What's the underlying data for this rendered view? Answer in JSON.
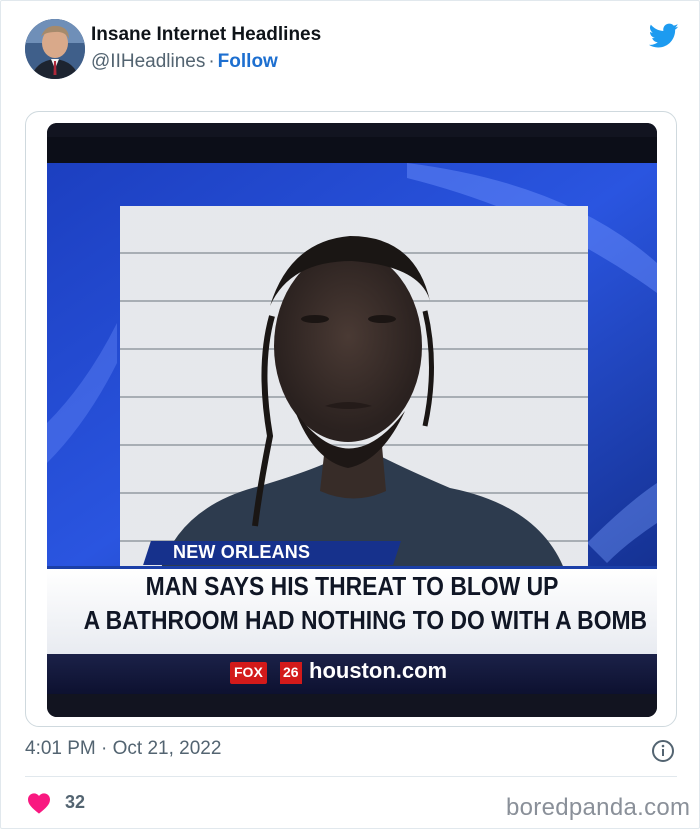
{
  "account": {
    "name": "Insane Internet Headlines",
    "handle": "@IIHeadlines",
    "separator": "·",
    "follow_label": "Follow"
  },
  "icons": {
    "brand": "twitter-bird-icon",
    "info": "info-icon",
    "like": "heart-icon"
  },
  "colors": {
    "twitter_blue": "#1d9bf0",
    "follow_blue": "#1d6fd0",
    "heart": "#f91880",
    "muted_text": "#536471"
  },
  "media": {
    "location": "NEW ORLEANS",
    "headline_line1": "MAN SAYS HIS THREAT TO BLOW UP",
    "headline_line2": "A BATHROOM HAD NOTHING TO DO WITH A BOMB",
    "logo_text": "FOX",
    "logo_number": "26",
    "website": "houston.com"
  },
  "tweet": {
    "timestamp": "4:01 PM · Oct 21, 2022",
    "like_count": "32"
  },
  "watermark": "boredpanda.com"
}
